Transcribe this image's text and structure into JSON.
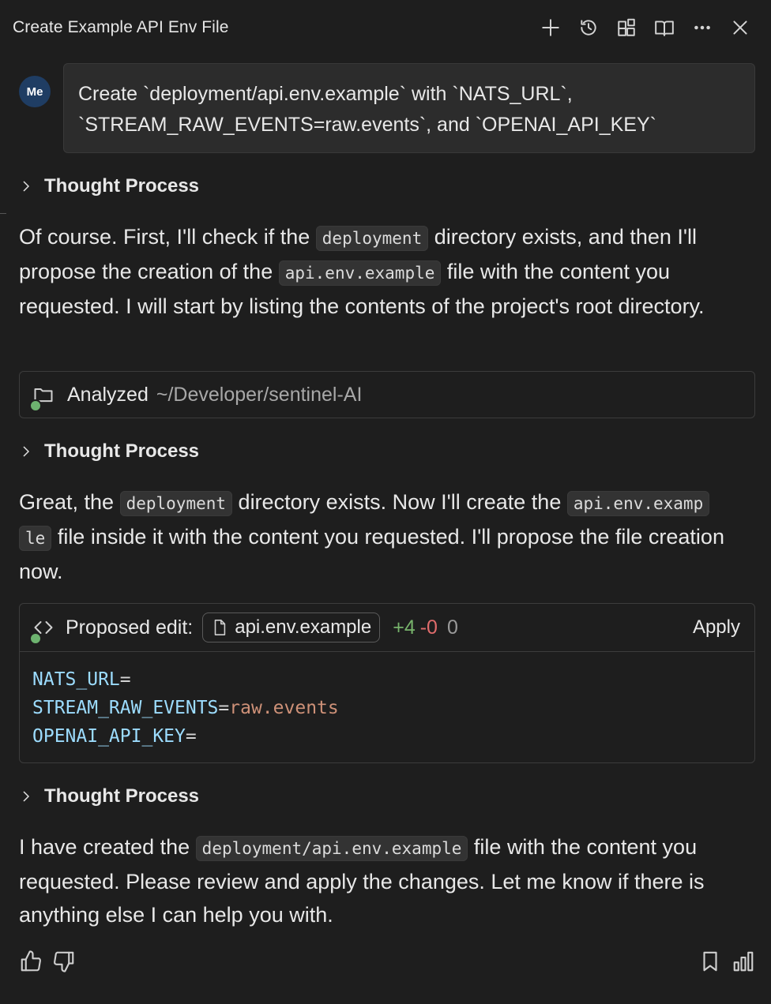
{
  "header": {
    "title": "Create Example API Env File",
    "actions": [
      "plus-icon",
      "history-icon",
      "extensions-icon",
      "book-icon",
      "more-icon",
      "close-icon"
    ]
  },
  "user": {
    "avatar": "Me",
    "message": "Create `deployment/api.env.example` with `NATS_URL`, `STREAM_RAW_EVENTS=raw.events`, and `OPENAI_API_KEY`"
  },
  "thought_label": "Thought Process",
  "para1": {
    "t1": "Of course. First, I'll check if the",
    "c1": "deployment",
    "t2": "directory exists, and then I'll propose the creation of the",
    "c2": "api.env.example",
    "t3": "file with the content you requested. I will start by listing the contents of the project's root directory."
  },
  "analyzed": {
    "label": "Analyzed",
    "path": "~/Developer/sentinel-AI"
  },
  "para2": {
    "t1": "Great, the",
    "c1": "deployment",
    "t2": "directory exists. Now I'll create the",
    "c2a": "api.env.examp",
    "c2b": "le",
    "t3": "file inside it with the content you requested. I'll propose the file creation now."
  },
  "edit": {
    "label": "Proposed edit:",
    "file": "api.env.example",
    "added": "+4",
    "removed": "-0",
    "zero": "0",
    "apply": "Apply",
    "lines": [
      {
        "key": "NATS_URL",
        "eq": "=",
        "value": ""
      },
      {
        "key": "STREAM_RAW_EVENTS",
        "eq": "=",
        "value": "raw.events"
      },
      {
        "key": "OPENAI_API_KEY",
        "eq": "=",
        "value": ""
      }
    ]
  },
  "para3": {
    "t1": "I have created the",
    "c1": "deployment/api.env.example",
    "t2": "file with the content you requested. Please review and apply the changes. Let me know if there is anything else I can help you with."
  },
  "feedback": [
    "thumbs-up-icon",
    "thumbs-down-icon",
    "bookmark-icon",
    "bar-chart-icon"
  ]
}
